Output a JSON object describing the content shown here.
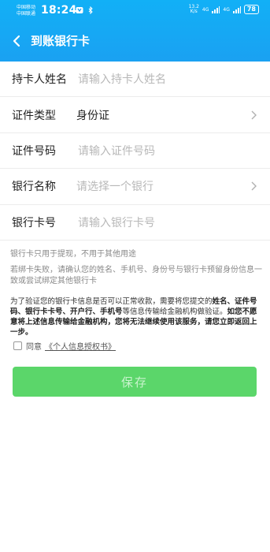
{
  "status_bar": {
    "carrier1": "中国移动",
    "carrier2": "中国联通",
    "time": "18:24",
    "speed_top": "13.2",
    "speed_bottom": "K/s",
    "signal1": "4G",
    "signal2": "4G",
    "battery": "78"
  },
  "nav": {
    "back_icon": "chevron-left-icon",
    "title": "到账银行卡"
  },
  "form": {
    "rows": [
      {
        "label": "持卡人姓名",
        "placeholder": "请输入持卡人姓名",
        "value": "",
        "has_chevron": false
      },
      {
        "label": "证件类型",
        "placeholder": "",
        "value": "身份证",
        "has_chevron": true
      },
      {
        "label": "证件号码",
        "placeholder": "请输入证件号码",
        "value": "",
        "has_chevron": false
      },
      {
        "label": "银行名称",
        "placeholder": "请选择一个银行",
        "value": "",
        "has_chevron": true
      },
      {
        "label": "银行卡号",
        "placeholder": "请输入银行卡号",
        "value": "",
        "has_chevron": false
      }
    ]
  },
  "tips": {
    "tip1": "银行卡只用于提现，不用于其他用途",
    "tip2": "若绑卡失败，请确认您的姓名、手机号、身份号与银行卡预留身份信息一致或尝试绑定其他银行卡",
    "tip3_part1": "为了验证您的银行卡信息是否可以正常收款，需要将您提交的",
    "tip3_bold1": "姓名、证件号码、银行卡卡号、开户行、手机号",
    "tip3_part2": "等信息传输给金融机构做验证。",
    "tip3_bold2": "如您不愿意将上述信息传输给金融机构，您将无法继续使用该服务，请您立即返回上一步。"
  },
  "agreement": {
    "checked": false,
    "prefix": "同意",
    "link": "《个人信息授权书》"
  },
  "save_button": {
    "label": "保存",
    "color": "#5bd66a"
  },
  "colors": {
    "header": "#1aa1f2",
    "placeholder": "#b8b8b8"
  }
}
